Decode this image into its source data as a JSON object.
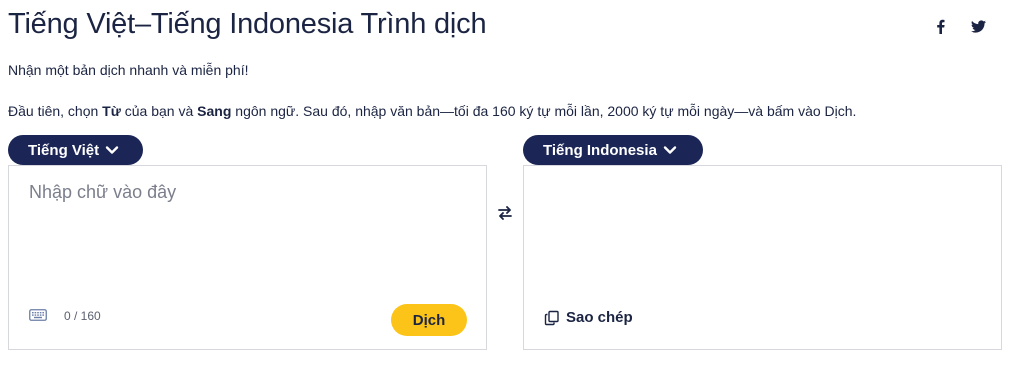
{
  "header": {
    "title": "Tiếng Việt–Tiếng Indonesia Trình dịch",
    "subtitle": "Nhận một bản dịch nhanh và miễn phí!",
    "social": {
      "facebook_icon": "facebook-icon",
      "twitter_icon": "twitter-icon"
    }
  },
  "instructions": {
    "part1": "Đầu tiên, chọn ",
    "from_word": "Từ",
    "part2": " của bạn và ",
    "to_word": "Sang",
    "part3": " ngôn ngữ. Sau đó, nhập văn bản—tối đa 160 ký tự mỗi lần, 2000 ký tự mỗi ngày—và bấm vào Dịch."
  },
  "source": {
    "language": "Tiếng Việt",
    "placeholder": "Nhập chữ vào đây",
    "value": "",
    "counter": "0 / 160",
    "translate_label": "Dịch",
    "keyboard_icon": "keyboard-icon"
  },
  "swap_icon": "swap-arrows-icon",
  "target": {
    "language": "Tiếng Indonesia",
    "copy_label": "Sao chép",
    "copy_icon": "copy-icon"
  },
  "colors": {
    "accent_navy": "#1b2656",
    "button_yellow": "#fcc418",
    "text": "#1b2442",
    "border": "#d6d8de"
  }
}
